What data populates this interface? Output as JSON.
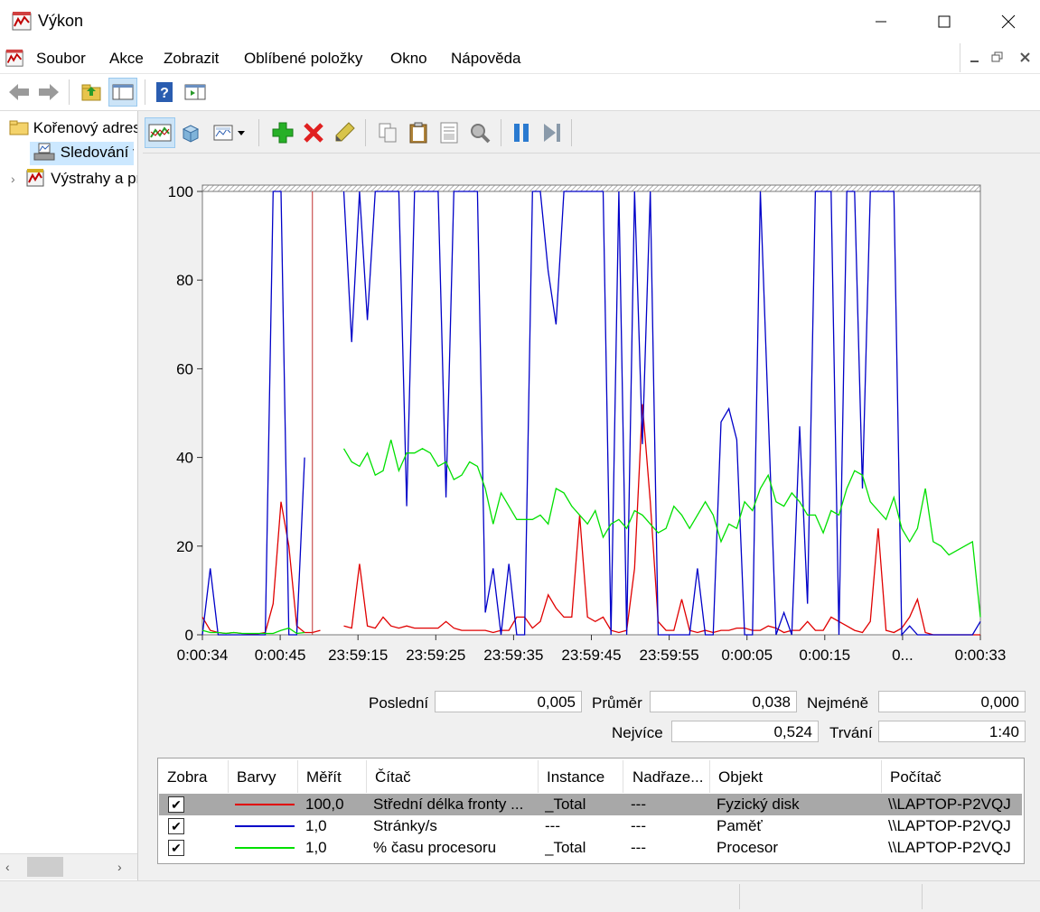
{
  "window": {
    "title": "Výkon"
  },
  "menu": {
    "items": [
      "Soubor",
      "Akce",
      "Zobrazit",
      "Oblíbené položky",
      "Okno",
      "Nápověda"
    ]
  },
  "tree": {
    "items": [
      {
        "label": "Kořenový adresář",
        "icon": "folder-icon"
      },
      {
        "label": "Sledování výkonu",
        "icon": "performance-monitor-icon"
      },
      {
        "label": "Výstrahy a protokoly výkonu",
        "icon": "alerts-icon"
      }
    ]
  },
  "stats": {
    "last_label": "Poslední",
    "last": "0,005",
    "avg_label": "Průměr",
    "avg": "0,038",
    "min_label": "Nejméně",
    "min": "0,000",
    "max_label": "Nejvíce",
    "max": "0,524",
    "duration_label": "Trvání",
    "duration": "1:40"
  },
  "legend": {
    "headers": [
      "Zobra",
      "Barvy",
      "Měřít",
      "Čítač",
      "Instance",
      "Nadřaze...",
      "Objekt",
      "Počítač"
    ],
    "rows": [
      {
        "show": "✔",
        "color": "#e00000",
        "scale": "100,0",
        "counter": "Střední délka fronty ...",
        "instance": "_Total",
        "parent": "---",
        "object": "Fyzický disk",
        "computer": "\\\\LAPTOP-P2VQJ"
      },
      {
        "show": "✔",
        "color": "#0000c8",
        "scale": "1,0",
        "counter": "Stránky/s",
        "instance": "---",
        "parent": "---",
        "object": "Paměť",
        "computer": "\\\\LAPTOP-P2VQJ"
      },
      {
        "show": "✔",
        "color": "#00e000",
        "scale": "1,0",
        "counter": "% času procesoru",
        "instance": "_Total",
        "parent": "---",
        "object": "Procesor",
        "computer": "\\\\LAPTOP-P2VQJ"
      }
    ]
  },
  "chart_data": {
    "type": "line",
    "ylim": [
      0,
      100
    ],
    "yticks": [
      "100",
      "80",
      "60",
      "40",
      "20",
      "0"
    ],
    "xticks": [
      "0:00:34",
      "0:00:45",
      "23:59:15",
      "23:59:25",
      "23:59:35",
      "23:59:45",
      "23:59:55",
      "0:00:05",
      "0:00:15",
      "0...",
      "0:00:33"
    ],
    "grid": false,
    "series": [
      {
        "name": "Střední délka fronty disku",
        "color": "#e00000",
        "x": [
          0,
          1,
          2,
          3,
          4,
          5,
          6,
          7,
          8,
          9,
          10,
          11,
          12,
          13,
          14,
          15,
          16,
          17,
          18,
          19,
          20,
          21,
          22,
          23,
          24,
          25,
          26,
          27,
          28,
          29,
          30,
          31,
          32,
          33,
          34,
          35,
          36,
          37,
          38,
          39,
          40,
          41,
          42,
          43,
          44,
          45,
          46,
          47,
          48,
          49,
          50,
          51,
          52,
          53,
          54,
          55,
          56,
          57,
          58,
          59,
          60,
          61,
          62,
          63,
          64,
          65,
          66,
          67,
          68,
          69,
          70,
          71,
          72,
          73,
          74,
          75,
          76,
          77,
          78,
          79,
          80,
          81,
          82,
          83,
          84,
          85,
          86,
          87,
          88,
          89,
          90,
          91,
          92,
          93,
          94,
          95,
          96,
          97,
          98,
          99
        ],
        "values": [
          4,
          1,
          0.5,
          0.3,
          0.5,
          0.3,
          0.2,
          0.2,
          0.5,
          7,
          30,
          20,
          2,
          0.5,
          0.5,
          1,
          null,
          null,
          2,
          1.5,
          16,
          2,
          1.5,
          4,
          2,
          1.5,
          2,
          1.5,
          1.5,
          1.5,
          1.5,
          3,
          1.5,
          1,
          1,
          1,
          1,
          0.5,
          1,
          1,
          4,
          4,
          1.5,
          3,
          9,
          6,
          4,
          4,
          27,
          4,
          3,
          4,
          1,
          0.5,
          1,
          15,
          52,
          30,
          3,
          1,
          1,
          8,
          1,
          0.5,
          1,
          0.5,
          1,
          1,
          1.5,
          1.5,
          1,
          1,
          2,
          1.5,
          0.5,
          1,
          1,
          3,
          1,
          1,
          4,
          3,
          2,
          1,
          0.5,
          3,
          24,
          1,
          0.5,
          1.5,
          4,
          8,
          0.5,
          0,
          0,
          0,
          0,
          0,
          0,
          0
        ]
      },
      {
        "name": "Stránky/s",
        "color": "#0000c8",
        "x": [
          0,
          1,
          2,
          3,
          4,
          5,
          6,
          7,
          8,
          9,
          10,
          11,
          12,
          13,
          14,
          15,
          16,
          17,
          18,
          19,
          20,
          21,
          22,
          23,
          24,
          25,
          26,
          27,
          28,
          29,
          30,
          31,
          32,
          33,
          34,
          35,
          36,
          37,
          38,
          39,
          40,
          41,
          42,
          43,
          44,
          45,
          46,
          47,
          48,
          49,
          50,
          51,
          52,
          53,
          54,
          55,
          56,
          57,
          58,
          59,
          60,
          61,
          62,
          63,
          64,
          65,
          66,
          67,
          68,
          69,
          70,
          71,
          72,
          73,
          74,
          75,
          76,
          77,
          78,
          79,
          80,
          81,
          82,
          83,
          84,
          85,
          86,
          87,
          88,
          89,
          90,
          91,
          92,
          93,
          94,
          95,
          96,
          97,
          98,
          99
        ],
        "values": [
          0,
          15,
          0,
          0,
          0,
          0,
          0,
          0,
          0,
          100,
          100,
          0,
          0,
          40,
          null,
          null,
          null,
          null,
          100,
          66,
          100,
          71,
          100,
          100,
          100,
          100,
          29,
          100,
          100,
          100,
          100,
          31,
          100,
          100,
          100,
          100,
          5,
          15,
          0,
          16,
          0,
          0,
          100,
          100,
          82,
          70,
          100,
          100,
          100,
          100,
          100,
          100,
          0,
          100,
          0,
          100,
          43,
          100,
          0,
          0,
          0,
          0,
          0,
          15,
          0,
          0,
          48,
          51,
          44,
          0,
          0,
          100,
          50,
          0,
          5,
          0,
          47,
          7,
          100,
          100,
          100,
          0,
          100,
          100,
          33,
          100,
          100,
          100,
          100,
          0,
          2,
          0,
          0,
          0,
          0,
          0,
          0,
          0,
          0,
          3
        ]
      },
      {
        "name": "% času procesoru",
        "color": "#00e000",
        "x": [
          0,
          1,
          2,
          3,
          4,
          5,
          6,
          7,
          8,
          9,
          10,
          11,
          12,
          13,
          14,
          15,
          16,
          17,
          18,
          19,
          20,
          21,
          22,
          23,
          24,
          25,
          26,
          27,
          28,
          29,
          30,
          31,
          32,
          33,
          34,
          35,
          36,
          37,
          38,
          39,
          40,
          41,
          42,
          43,
          44,
          45,
          46,
          47,
          48,
          49,
          50,
          51,
          52,
          53,
          54,
          55,
          56,
          57,
          58,
          59,
          60,
          61,
          62,
          63,
          64,
          65,
          66,
          67,
          68,
          69,
          70,
          71,
          72,
          73,
          74,
          75,
          76,
          77,
          78,
          79,
          80,
          81,
          82,
          83,
          84,
          85,
          86,
          87,
          88,
          89,
          90,
          91,
          92,
          93,
          94,
          95,
          96,
          97,
          98,
          99
        ],
        "values": [
          1,
          0.5,
          0.5,
          0.3,
          0.5,
          0.3,
          0.3,
          0.3,
          0.3,
          0.3,
          1,
          1.5,
          0.3,
          0.5,
          null,
          null,
          null,
          null,
          42,
          39,
          38,
          41,
          36,
          37,
          44,
          37,
          41,
          41,
          42,
          41,
          38,
          39,
          35,
          36,
          39,
          38,
          33,
          25,
          32,
          29,
          26,
          26,
          26,
          27,
          25,
          33,
          32,
          29,
          27,
          25,
          28,
          22,
          25,
          26,
          24,
          28,
          27,
          25,
          23,
          24,
          29,
          27,
          24,
          27,
          30,
          27,
          21,
          25,
          24,
          30,
          28,
          33,
          36,
          30,
          29,
          32,
          30,
          27,
          27,
          23,
          28,
          27,
          33,
          37,
          36,
          30,
          28,
          26,
          31,
          24,
          21,
          24,
          33,
          21,
          20,
          18,
          19,
          20,
          21,
          4
        ]
      }
    ]
  }
}
